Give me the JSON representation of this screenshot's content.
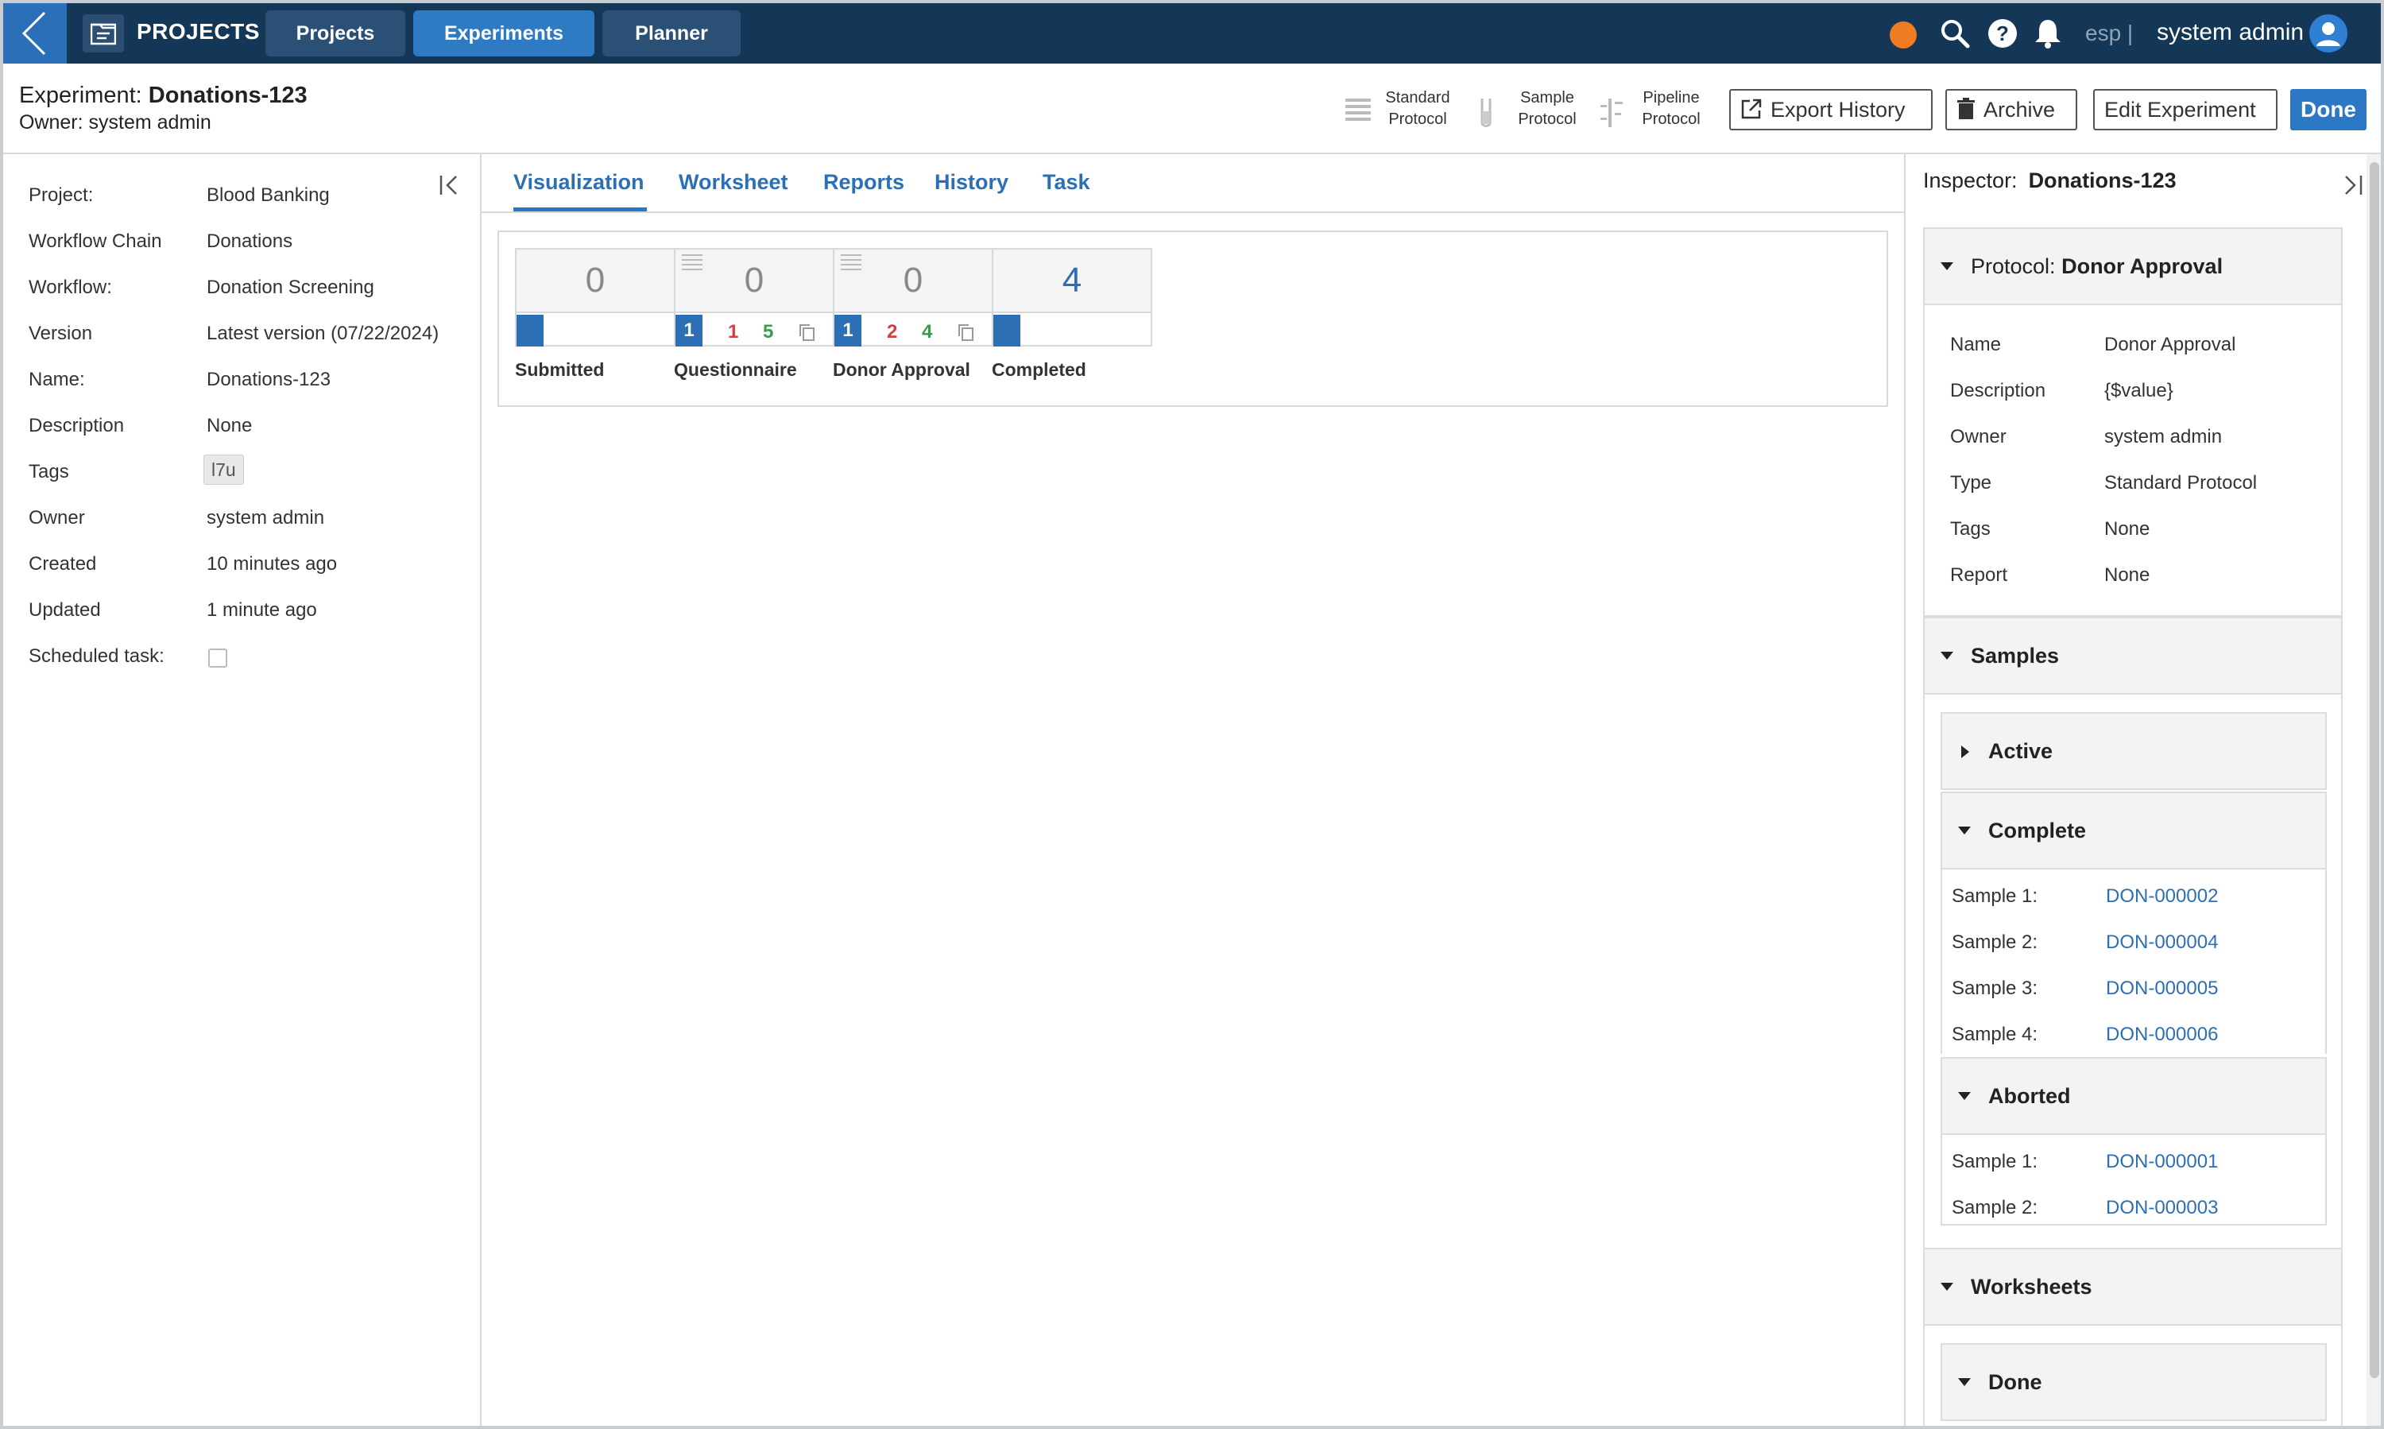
{
  "nav": {
    "section_label": "PROJECTS",
    "tabs": [
      {
        "label": "Projects",
        "active": false
      },
      {
        "label": "Experiments",
        "active": true
      },
      {
        "label": "Planner",
        "active": false
      }
    ],
    "tenant": "esp |",
    "user": "system admin",
    "status_color": "#ef7c21",
    "icons": [
      "back-chevron-icon",
      "projects-folder-icon",
      "search-icon",
      "help-icon",
      "bell-icon",
      "user-avatar-icon"
    ]
  },
  "header": {
    "title_prefix": "Experiment:",
    "title_name": "Donations-123",
    "owner_line": "Owner: system admin",
    "protocol_buttons": [
      {
        "line1": "Standard",
        "line2": "Protocol"
      },
      {
        "line1": "Sample",
        "line2": "Protocol"
      },
      {
        "line1": "Pipeline",
        "line2": "Protocol"
      }
    ],
    "export_label": "Export History",
    "archive_label": "Archive",
    "edit_label": "Edit Experiment",
    "done_label": "Done"
  },
  "details": {
    "rows": [
      {
        "key": "Project:",
        "value": "Blood Banking"
      },
      {
        "key": "Workflow Chain",
        "value": "Donations"
      },
      {
        "key": "Workflow:",
        "value": "Donation Screening"
      },
      {
        "key": "Version",
        "value": "Latest version (07/22/2024)"
      },
      {
        "key": "Name:",
        "value": "Donations-123"
      },
      {
        "key": "Description",
        "value": "None"
      },
      {
        "key": "Tags",
        "value": "l7u"
      },
      {
        "key": "Owner",
        "value": "system admin"
      },
      {
        "key": "Created",
        "value": "10 minutes ago"
      },
      {
        "key": "Updated",
        "value": "1 minute ago"
      },
      {
        "key": "Scheduled task:",
        "value": ""
      }
    ],
    "scheduled_task_checked": false
  },
  "center": {
    "tabs": [
      "Visualization",
      "Worksheet",
      "Reports",
      "History",
      "Task"
    ],
    "active_tab": "Visualization",
    "nodes": [
      {
        "label": "Submitted",
        "count": "0",
        "active": "",
        "failed": "",
        "done": "",
        "highlight": false
      },
      {
        "label": "Questionnaire",
        "count": "0",
        "active": "1",
        "failed": "1",
        "done": "5",
        "highlight": false
      },
      {
        "label": "Donor Approval",
        "count": "0",
        "active": "1",
        "failed": "2",
        "done": "4",
        "highlight": false
      },
      {
        "label": "Completed",
        "count": "4",
        "active": "",
        "failed": "",
        "done": "",
        "highlight": true
      }
    ]
  },
  "inspector": {
    "label": "Inspector:",
    "name": "Donations-123",
    "protocol": {
      "label": "Protocol:",
      "name": "Donor Approval",
      "rows": [
        {
          "key": "Name",
          "value": "Donor Approval"
        },
        {
          "key": "Description",
          "value": "{$value}"
        },
        {
          "key": "Owner",
          "value": "system admin"
        },
        {
          "key": "Type",
          "value": "Standard Protocol"
        },
        {
          "key": "Tags",
          "value": "None"
        },
        {
          "key": "Report",
          "value": "None"
        }
      ]
    },
    "samples": {
      "label": "Samples",
      "active_label": "Active",
      "complete_label": "Complete",
      "complete": [
        {
          "key": "Sample 1:",
          "value": "DON-000002"
        },
        {
          "key": "Sample 2:",
          "value": "DON-000004"
        },
        {
          "key": "Sample 3:",
          "value": "DON-000005"
        },
        {
          "key": "Sample 4:",
          "value": "DON-000006"
        }
      ],
      "aborted_label": "Aborted",
      "aborted": [
        {
          "key": "Sample 1:",
          "value": "DON-000001"
        },
        {
          "key": "Sample 2:",
          "value": "DON-000003"
        }
      ]
    },
    "worksheets": {
      "label": "Worksheets",
      "done_label": "Done"
    }
  }
}
